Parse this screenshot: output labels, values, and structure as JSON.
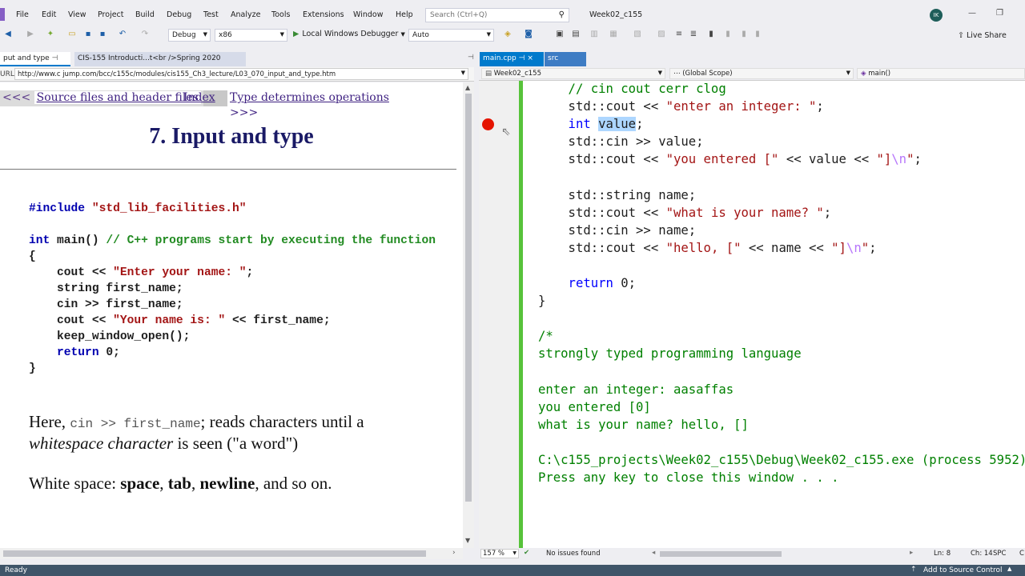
{
  "menubar": {
    "items": [
      "File",
      "Edit",
      "View",
      "Project",
      "Build",
      "Debug",
      "Test",
      "Analyze",
      "Tools",
      "Extensions",
      "Window",
      "Help"
    ],
    "search_placeholder": "Search (Ctrl+Q)",
    "solution_title": "Week02_c155",
    "avatar_initials": "IK"
  },
  "toolbar": {
    "configuration": "Debug",
    "platform": "x86",
    "run_label": "Local Windows Debugger",
    "run_mode": "Auto",
    "live_share": "Live Share"
  },
  "left_pane": {
    "tabs": [
      "put and type",
      "CIS-155 Introducti...t<br />Spring 2020"
    ],
    "url_label": "URL:",
    "url": "http://www.c jump.com/bcc/c155c/modules/cis155_Ch3_lecture/L03_070_input_and_type.htm",
    "nav": {
      "prev_arrows": "<<<",
      "prev": "Source files and header files",
      "index": "Index",
      "next": "Type determines operations",
      "next_arrows": ">>>"
    },
    "title": "7. Input and type",
    "code": {
      "include_kw": "#include",
      "include_file": "\"std_lib_facilities.h\"",
      "main_kw": "int",
      "main_sig": " main() ",
      "main_comment": "// C++ programs start by executing the function",
      "open_brace": "{",
      "l1_a": "    cout << ",
      "l1_str": "\"Enter your name: \"",
      "l1_b": ";",
      "l2": "    string first_name;",
      "l3": "    cin >> first_name;",
      "l4_a": "    cout << ",
      "l4_str": "\"Your name is: \"",
      "l4_b": " << first_name;",
      "l5": "    keep_window_open();",
      "l6_kw": "    return",
      "l6_b": " 0;",
      "close_brace": "}"
    },
    "prose1_a": "Here, ",
    "prose1_code": "cin >> first_name",
    "prose1_b": "; reads characters until a",
    "prose2_em": "whitespace character",
    "prose2_b": " is seen (\"a word\")",
    "prose3_a": "White space: ",
    "prose3_space": "space",
    "prose3_c1": ", ",
    "prose3_tab": "tab",
    "prose3_c2": ", ",
    "prose3_newline": "newline",
    "prose3_end": ", and so on."
  },
  "right_pane": {
    "tabs": [
      "main.cpp",
      "src"
    ],
    "tab_pin": "⊣",
    "tab_close": "×",
    "nav_project": "Week02_c155",
    "nav_scope": "(Global Scope)",
    "nav_member": "main()",
    "code": {
      "c1": "    // cin cout cerr clog",
      "c2_a": "    std::cout << ",
      "c2_s": "\"enter an integer: \"",
      "c2_b": ";",
      "c3_kw": "    int ",
      "c3_sel": "value",
      "c3_b": ";",
      "c4": "    std::cin >> value;",
      "c5_a": "    std::cout << ",
      "c5_s1": "\"you entered [\"",
      "c5_b": " << value << ",
      "c5_s2": "\"]",
      "c5_esc": "\\n",
      "c5_s3": "\"",
      "c5_c": ";",
      "c6": "    std::string name;",
      "c7_a": "    std::cout << ",
      "c7_s": "\"what is your name? \"",
      "c7_b": ";",
      "c8": "    std::cin >> name;",
      "c9_a": "    std::cout << ",
      "c9_s1": "\"hello, [\"",
      "c9_b": " << name << ",
      "c9_s2": "\"]",
      "c9_esc": "\\n",
      "c9_s3": "\"",
      "c9_c": ";",
      "c10_kw": "    return",
      "c10_b": " 0;",
      "c11": "}",
      "c12": "/*",
      "c13": "strongly typed programming language",
      "c14": "enter an integer: aasaffas",
      "c15": "you entered [0]",
      "c16": "what is your name? hello, []",
      "c17": "C:\\c155_projects\\Week02_c155\\Debug\\Week02_c155.exe (process 5952)",
      "c18": "Press any key to close this window . . ."
    },
    "zoom": "157 %",
    "issues": "No issues found",
    "ln": "Ln: 8",
    "ch": "Ch: 14",
    "spc": "SPC",
    "crlf": "C"
  },
  "status": {
    "text": "Ready",
    "source_control": "Add to Source Control"
  },
  "colors": {
    "accent": "#007acc",
    "breakpoint": "#e51400",
    "status_bar": "#3f5569"
  }
}
